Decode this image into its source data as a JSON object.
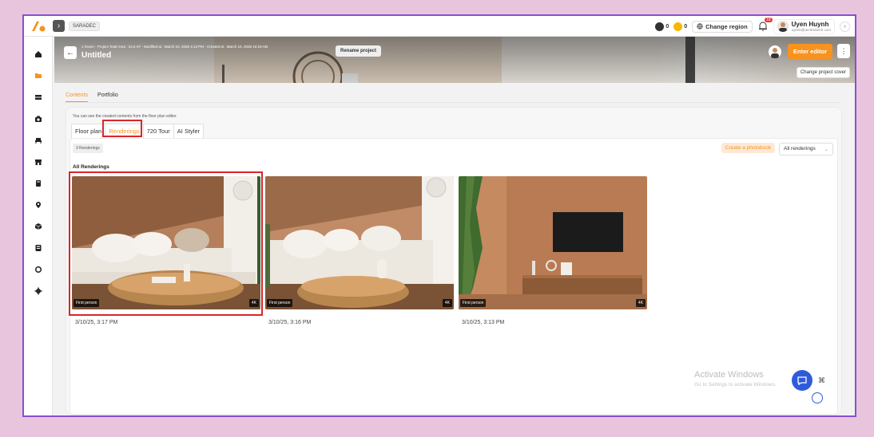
{
  "topbar": {
    "brand": "SARADEC",
    "credit_a": "0",
    "credit_b": "0",
    "region_label": "Change region",
    "notifications": "18",
    "user_name": "Uyen Huynh",
    "user_email": "uyenh@archisketch.com"
  },
  "sidebar": {
    "items": [
      "home-icon",
      "folder-icon",
      "layers-icon",
      "camera-icon",
      "sofa-icon",
      "store-icon",
      "book-icon",
      "location-icon",
      "cube-icon",
      "id-card-icon",
      "circle-icon",
      "gear-icon"
    ]
  },
  "cover": {
    "meta": "1 Room - Project Total Area : 24.5 m² - Modified at : March 10, 2025 4:13 PM - Created at : March 10, 2025 10:19 AM",
    "title": "Untitled",
    "rename_label": "Rename project",
    "enter_label": "Enter editor",
    "cover_tip": "Change project cover"
  },
  "main_tabs": [
    "Contents",
    "Portfolio"
  ],
  "panel": {
    "info": "You can see the created contents from the floor plan editor.",
    "sub_tabs": [
      "Floor plan",
      "Renderings",
      "720 Tour",
      "AI Styler"
    ],
    "count": "3 Renderings",
    "photobook_label": "Create a photobook",
    "filter_value": "All renderings",
    "section_title": "All Renderings"
  },
  "renderings": [
    {
      "label": "First person",
      "resolution": "4K",
      "date": "3/10/25, 3:17 PM"
    },
    {
      "label": "First person",
      "resolution": "4K",
      "date": "3/10/25, 3:16 PM"
    },
    {
      "label": "First person",
      "resolution": "4K",
      "date": "3/10/25, 3:13 PM"
    }
  ],
  "watermark": {
    "title": "Activate Windows",
    "subtitle": "Go to Settings to activate Windows."
  },
  "colors": {
    "accent": "#f7931e",
    "highlight": "#d8262a",
    "frame": "#8a4fd0",
    "background": "#e8c5dc"
  }
}
